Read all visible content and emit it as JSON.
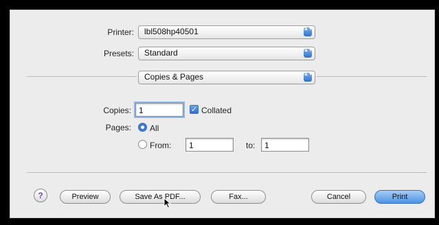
{
  "printer": {
    "label": "Printer:",
    "value": "lbl508hp40501",
    "arrows_glyph": "▲▼"
  },
  "presets": {
    "label": "Presets:",
    "value": "Standard",
    "arrows_glyph": "▲▼"
  },
  "section": {
    "value": "Copies & Pages",
    "arrows_glyph": "▲▼"
  },
  "copies": {
    "label": "Copies:",
    "value": "1",
    "collated_label": "Collated",
    "collated_checked": true,
    "check_glyph": "✓"
  },
  "pages": {
    "label": "Pages:",
    "all_label": "All",
    "from_label": "From:",
    "from_value": "1",
    "to_label": "to:",
    "to_value": "1",
    "selected": "all"
  },
  "buttons": {
    "help_glyph": "?",
    "preview": "Preview",
    "save_as_pdf": "Save As PDF...",
    "fax": "Fax...",
    "cancel": "Cancel",
    "print": "Print"
  },
  "colors": {
    "accent": "#3a78d8",
    "help_icon": "#7a3fb8",
    "background": "#ececec"
  }
}
